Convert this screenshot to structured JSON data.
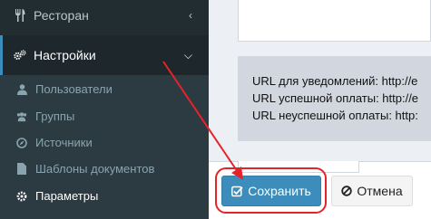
{
  "sidebar": {
    "top_item": {
      "label": "Ресторан",
      "icon": "cutlery-icon"
    },
    "active_item": {
      "label": "Настройки",
      "icon": "cogs-icon"
    },
    "sub_items": [
      {
        "label": "Пользователи",
        "icon": "user-icon"
      },
      {
        "label": "Группы",
        "icon": "users-icon"
      },
      {
        "label": "Источники",
        "icon": "compass-icon"
      },
      {
        "label": "Шаблоны документов",
        "icon": "file-icon"
      },
      {
        "label": "Параметры",
        "icon": "gear-icon"
      }
    ]
  },
  "info": {
    "lines": [
      "URL для уведомлений: http://e",
      "URL успешной оплаты: http://e",
      "URL неуспешной оплаты: http:"
    ]
  },
  "footer": {
    "save_label": "Сохранить",
    "cancel_label": "Отмена"
  },
  "colors": {
    "sidebar_bg": "#222d32",
    "submenu_bg": "#2c3b41",
    "accent": "#3c8dbc",
    "annotation_red": "#e4232a"
  }
}
